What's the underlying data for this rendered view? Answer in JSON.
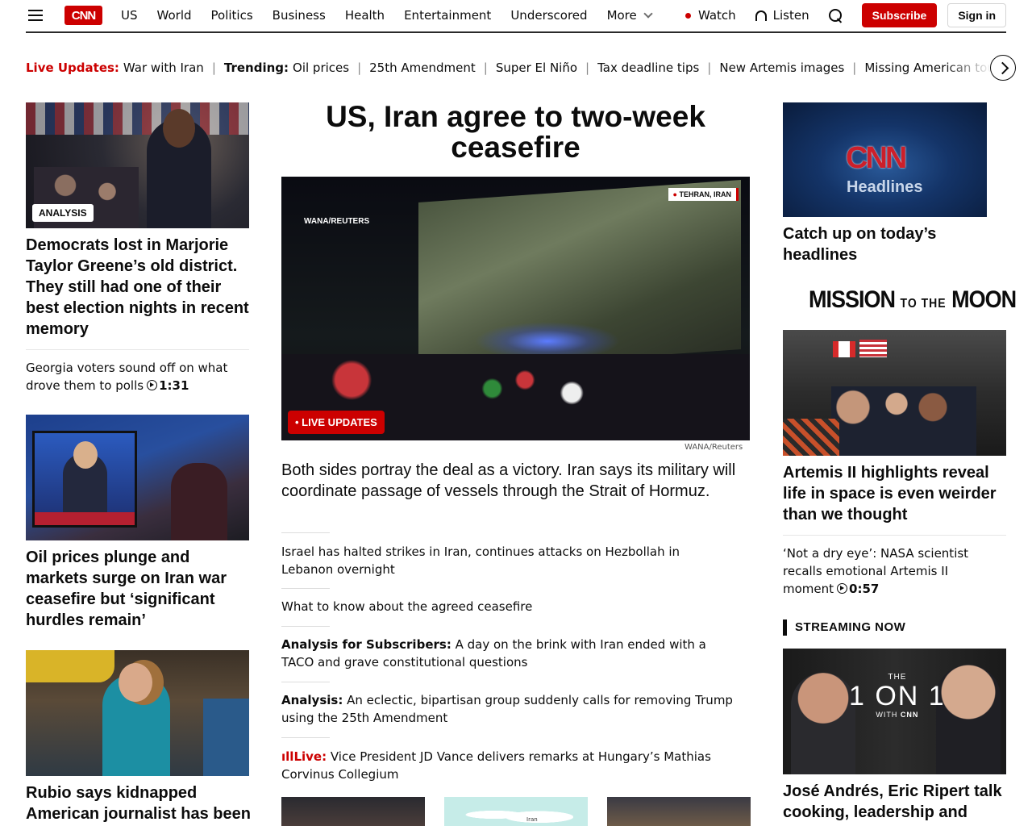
{
  "header": {
    "logo": "CNN",
    "nav": [
      "US",
      "World",
      "Politics",
      "Business",
      "Health",
      "Entertainment",
      "Underscored"
    ],
    "more": "More",
    "watch": "Watch",
    "listen": "Listen",
    "subscribe": "Subscribe",
    "signin": "Sign in"
  },
  "trending": {
    "live_label": "Live Updates:",
    "live_topic": "War with Iran",
    "trending_label": "Trending:",
    "items": [
      "Oil prices",
      "25th Amendment",
      "Super El Niño",
      "Tax deadline tips",
      "New Artemis images",
      "Missing American tourist"
    ]
  },
  "left": {
    "story1": {
      "tag": "ANALYSIS",
      "headline": "Democrats lost in Marjorie Taylor Greene’s old district. They still had one of their best election nights in recent memory",
      "sub": "Georgia voters sound off on what drove them to polls",
      "duration": "1:31"
    },
    "story2": {
      "headline": "Oil prices plunge and markets surge on Iran war ceasefire but ‘significant hurdles remain’"
    },
    "story3": {
      "headline": "Rubio says kidnapped American journalist has been"
    }
  },
  "center": {
    "headline": "US, Iran agree to two-week ceasefire",
    "image_credit_overlay": "WANA/REUTERS",
    "location": "TEHRAN, IRAN",
    "live_tag": "LIVE UPDATES",
    "photo_credit": "WANA/Reuters",
    "lede": "Both sides portray the deal as a victory. Iran says its military will coordinate passage of vessels through the Strait of Hormuz.",
    "items": [
      {
        "prefix": "",
        "text": "Israel has halted strikes in Iran, continues attacks on Hezbollah in Lebanon overnight"
      },
      {
        "prefix": "",
        "text": "What to know about the agreed ceasefire"
      },
      {
        "prefix": "Analysis for Subscribers:",
        "text": "A day on the brink with Iran ended with a TACO and grave constitutional questions"
      },
      {
        "prefix": "Analysis:",
        "text": "An eclectic, bipartisan group suddenly calls for removing Trump using the 25th Amendment"
      },
      {
        "prefix": "Live:",
        "text": "Vice President JD Vance delivers remarks at Hungary’s Mathias Corvinus Collegium"
      }
    ],
    "map_label": "Iran"
  },
  "right": {
    "headlines_logo": "CNN",
    "headlines_word": "Headlines",
    "headlines_title": "Catch up on today’s headlines",
    "mission": {
      "a": "MISSION",
      "b": "TO THE",
      "c": "MOON"
    },
    "artemis_headline": "Artemis II highlights reveal life in space is even weirder than we thought",
    "artemis_sub": "‘Not a dry eye’: NASA scientist recalls emotional Artemis II moment",
    "artemis_duration": "0:57",
    "streaming_label": "STREAMING NOW",
    "show": {
      "the": "THE",
      "title": "1 ON 1",
      "with": "WITH",
      "brand": "CNN"
    },
    "show_headline": "José Andrés, Eric Ripert talk cooking, leadership and"
  }
}
